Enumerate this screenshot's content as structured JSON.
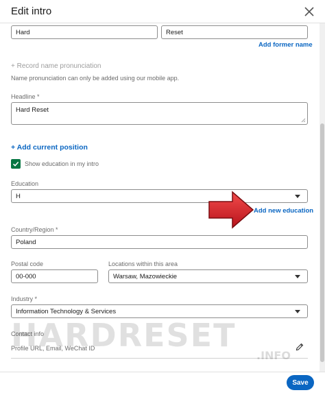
{
  "header": {
    "title": "Edit intro"
  },
  "name": {
    "first_value": "Hard",
    "last_value": "Reset",
    "add_former_name": "Add former name"
  },
  "pronunciation": {
    "label": "+ Record name pronunciation",
    "note": "Name pronunciation can only be added using our mobile app."
  },
  "headline": {
    "label": "Headline *",
    "value": "Hard Reset"
  },
  "position": {
    "add_label": "+ Add current position"
  },
  "education": {
    "checkbox_label": "Show education in my intro",
    "checked": true,
    "label": "Education",
    "value": "H",
    "add_new": "Add new education"
  },
  "country": {
    "label": "Country/Region *",
    "value": "Poland"
  },
  "postal": {
    "label": "Postal code",
    "value": "00-000"
  },
  "location": {
    "label": "Locations within this area",
    "value": "Warsaw, Mazowieckie"
  },
  "industry": {
    "label": "Industry *",
    "value": "Information Technology & Services"
  },
  "contact": {
    "label": "Contact info",
    "value": "Profile URL, Email, WeChat ID"
  },
  "footer": {
    "save_label": "Save"
  },
  "watermark": {
    "text": "HARDRESET",
    "sub": ".INFO"
  },
  "colors": {
    "accent": "#0a66c2",
    "check": "#057642",
    "arrow": "#d9232b"
  }
}
